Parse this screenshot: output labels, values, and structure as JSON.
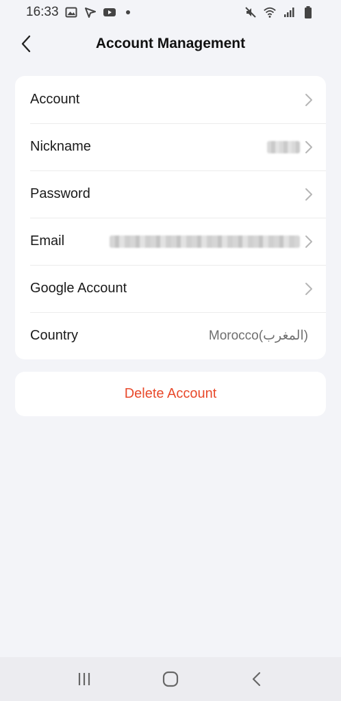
{
  "status_bar": {
    "time": "16:33",
    "left_icons": [
      "gallery-icon",
      "location-arrow-icon",
      "youtube-icon",
      "notification-dot-icon"
    ],
    "right_icons": [
      "mute-icon",
      "wifi-icon",
      "signal-icon",
      "battery-icon"
    ]
  },
  "header": {
    "title": "Account Management"
  },
  "settings": {
    "rows": [
      {
        "label": "Account",
        "value": ""
      },
      {
        "label": "Nickname",
        "value": ""
      },
      {
        "label": "Password",
        "value": ""
      },
      {
        "label": "Email",
        "value": ""
      },
      {
        "label": "Google Account",
        "value": ""
      },
      {
        "label": "Country",
        "value": "Morocco(المغرب)"
      }
    ]
  },
  "delete": {
    "label": "Delete Account"
  },
  "colors": {
    "background": "#f3f4f8",
    "card": "#ffffff",
    "danger": "#e8492b"
  }
}
